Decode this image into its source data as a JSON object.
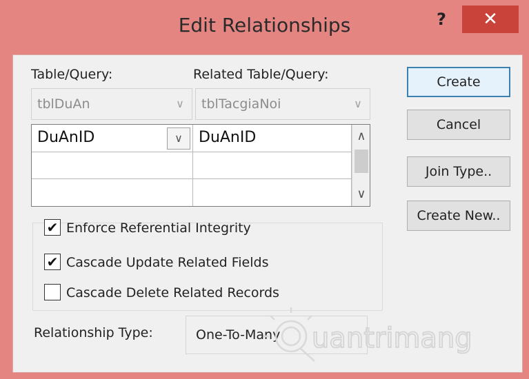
{
  "window": {
    "title": "Edit Relationships",
    "help_glyph": "?",
    "close_glyph": "✕"
  },
  "labels": {
    "table_query": "Table/Query:",
    "related_table_query": "Related Table/Query:",
    "relationship_type": "Relationship Type:"
  },
  "combos": {
    "table": {
      "value": "tblDuAn"
    },
    "related": {
      "value": "tblTacgiaNoi"
    }
  },
  "field_grid": {
    "rows": [
      {
        "left": "DuAnID",
        "right": "DuAnID"
      },
      {
        "left": "",
        "right": ""
      },
      {
        "left": "",
        "right": ""
      }
    ]
  },
  "options": {
    "enforce": {
      "label": "Enforce Referential Integrity",
      "checked": true
    },
    "cascade_update": {
      "label": "Cascade Update Related Fields",
      "checked": true
    },
    "cascade_delete": {
      "label": "Cascade Delete Related Records",
      "checked": false
    }
  },
  "relationship_type_value": "One-To-Many",
  "buttons": {
    "create": "Create",
    "cancel": "Cancel",
    "join_type": "Join Type..",
    "create_new": "Create New.."
  },
  "watermark": {
    "text": "uantrimang"
  },
  "colors": {
    "title_bar": "#e48582",
    "close_button": "#c9433a",
    "default_button_border": "#3c7fb1"
  }
}
